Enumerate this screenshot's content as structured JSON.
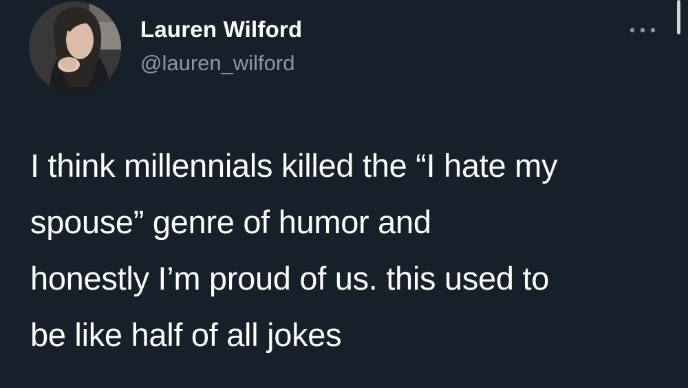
{
  "tweet": {
    "author": {
      "display_name": "Lauren Wilford",
      "handle": "@lauren_wilford",
      "avatar_icon": "profile-photo"
    },
    "more_icon": "ellipsis-icon",
    "text_lines": [
      "I think millennials killed the “I hate my",
      "spouse” genre of humor and",
      "honestly I’m proud of us. this used to",
      "be like half of all jokes"
    ]
  },
  "colors": {
    "background": "#15202b",
    "text_primary": "#ffffff",
    "text_secondary": "#8899a6"
  }
}
